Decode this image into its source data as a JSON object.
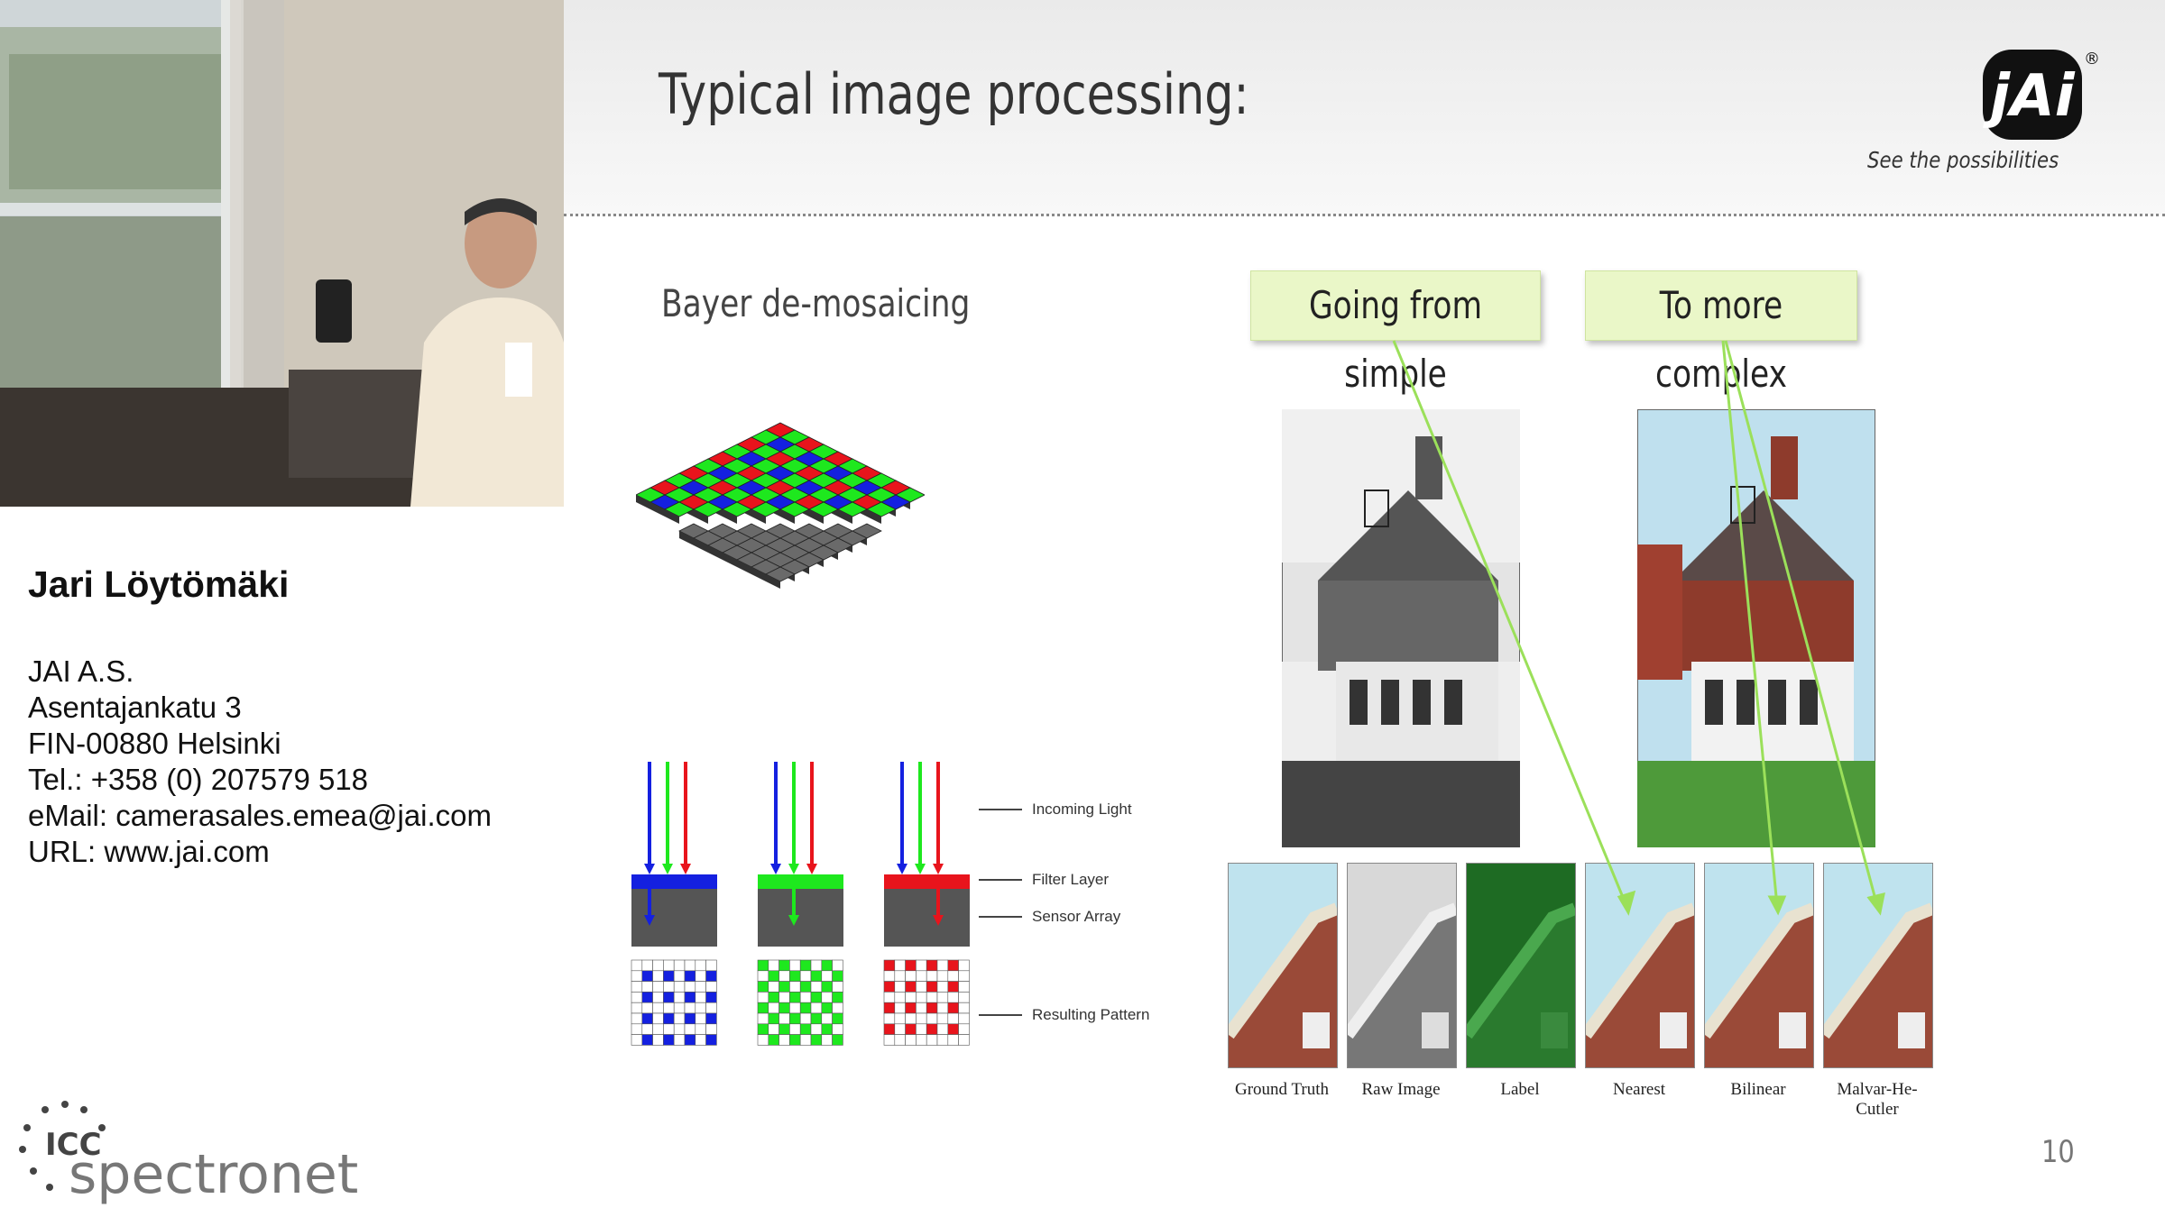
{
  "speaker": {
    "name": "Jari Löytömäki",
    "company": "JAI A.S.",
    "street": "Asentajankatu 3",
    "city": "FIN-00880 Helsinki",
    "phone": "Tel.: +358 (0) 207579 518",
    "email": "eMail: camerasales.emea@jai.com",
    "url": "URL: www.jai.com"
  },
  "footer": {
    "icc_label": "ICC",
    "brand": "spectronet"
  },
  "slide": {
    "title": "Typical image processing:",
    "logo_text": "jAi",
    "logo_reg": "®",
    "tagline": "See the possibilities",
    "subtitle": "Bayer de-mosaicing",
    "callout_simple": "Going from simple",
    "callout_complex": "To more complex",
    "page_number": "10",
    "diagram_labels": {
      "incoming_light": "Incoming Light",
      "filter_layer": "Filter Layer",
      "sensor_array": "Sensor Array",
      "resulting_pattern": "Resulting Pattern"
    },
    "thumbnails": [
      {
        "label": "Ground Truth"
      },
      {
        "label": "Raw Image"
      },
      {
        "label": "Label"
      },
      {
        "label": "Nearest"
      },
      {
        "label": "Bilinear"
      },
      {
        "label": "Malvar-He-Cutler"
      }
    ]
  },
  "colors": {
    "bayer_red": "#e8141c",
    "bayer_green": "#1ee81e",
    "bayer_blue": "#1420e0",
    "callout_bg": "#eaf7c8",
    "arrow_green": "#9be05a"
  }
}
